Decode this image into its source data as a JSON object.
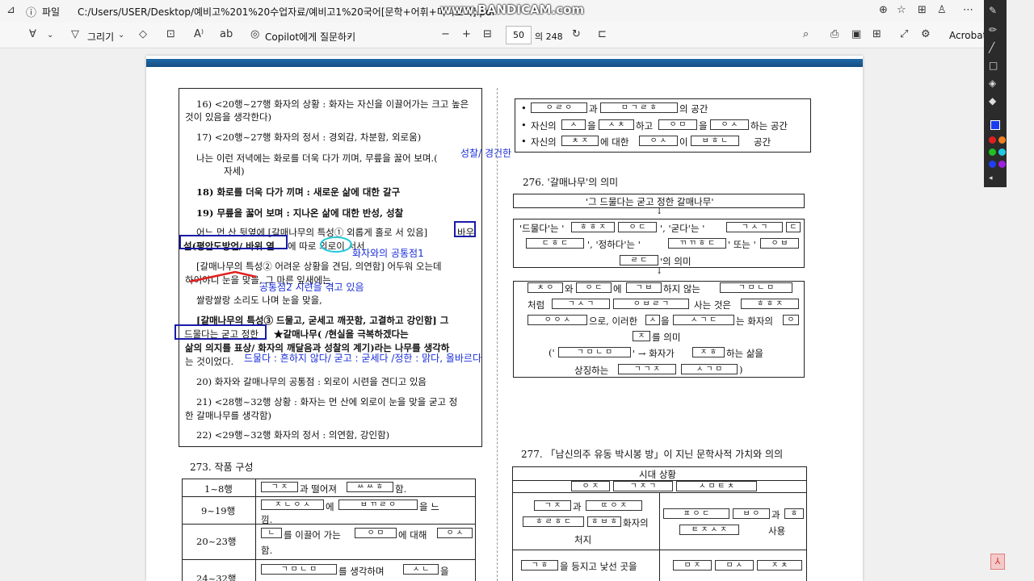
{
  "browser": {
    "file_label": "파일",
    "path": "C:/Users/USER/Desktop/예비고%201%20수업자료/예비고1%20국어[문학+어휘+미니모의].pdf",
    "watermark": "www.BANDICAM.com"
  },
  "toolbar": {
    "draw_label": "그리기",
    "copilot_label": "Copilot에게 질문하기",
    "page_current": "50",
    "page_total": "의 248",
    "acrobat_label": "Acrobat S"
  },
  "doc": {
    "left": {
      "l16a": "16) <20행~27행 화자의 상황 : 화자는 자신을 이끌어가는 크고 높은",
      "l16b": "것이 있음을 생각한다)",
      "l17": "17) <20행~27행 화자의 정서 : 경외감, 차분함, 외로움)",
      "l17t1": "나는 이런 저녁에는 화로를 더욱 다가 끼며, 무릎을 꿇어 보며.(",
      "l17t2": "자세)",
      "l18": "18) 화로를 더욱 다가 끼며 : 새로운 삶에 대한 갈구",
      "l19": "19) 무릎을 꿇어 보며 : 지나온 삶에 대한 반성, 성찰",
      "p1a": "어느 먼 산 뒷옆에 [갈매나무의 특성① 외롭게 홀로 서 있음]",
      "p1a_end": "바우",
      "p1b": "섶(평안도방언/ 바위 옆",
      "p1b2": "에 따로 외로이 서서",
      "p2a": "[갈매나무의 특성② 어려운 상황을 견딤, 의연함] 어두워 오는데",
      "p2b": "하이야니 눈을 맞을, 그 마른 잎새에는",
      "p2c": "쌀랑쌀랑 소리도 나며 눈을 맞을,",
      "p3a": "[갈매나무의 특성③ 드물고, 굳세고 깨끗함, 고결하고 강인함] 그",
      "p3b": "드물다는 굳고 정한",
      "p3b2": "★갈매나무(                    /현실을 극복하겠다는",
      "p3c": "삶의 의지를 표상/ 화자의 깨달음과 성찰의 계기)라는 나무를 생각하",
      "p3d": "는 것이었다.",
      "l20": "20) 화자와 갈매나무의 공통점 : 외로이 시련을 견디고 있음",
      "l21a": "21) <28행~32행 상황 : 화자는 먼 산에 외로이 눈을 맞을 굳고 정",
      "l21b": "한 갈매나무를 생각함)",
      "l22": "22) <29행~32행 화자의 정서 : 의연함, 강인함)",
      "h273": "273. 작품 구성",
      "rows": [
        {
          "range": "1~8행",
          "text": "과 떨어져",
          "box1": "ㄱ ㅈ",
          "box2": "ㅆ ㅆ ㅎ",
          "end": "함."
        },
        {
          "range": "9~19행",
          "text": "에",
          "box1": "ㅈ ㄴ ㅇ ㅅ",
          "box2": "ㅂ ㄲ ㄹ ㅇ",
          "end": "을 느",
          "line2": "낌."
        },
        {
          "range": "20~23행",
          "text": "를 이끌어 가는",
          "box1": "ㄴ",
          "box2": "ㅇ ㅁ",
          "end": "에 대해",
          "box3": "ㅇ ㅅ",
          "line2": "함."
        },
        {
          "range": "24~32행",
          "text": "를 생각하며",
          "box1": "ㄱ ㅁ ㄴ ㅁ",
          "box2": "ㅅ ㄴ",
          "end": "을"
        }
      ]
    },
    "right": {
      "bul1_box1": "ㅇ ㄹ ㅇ",
      "bul1_t1": "과",
      "bul1_box2": "ㅁ ㄱ ㄹ ㅎ",
      "bul1_t2": "의 공간",
      "bul2_t1": "자신의",
      "bul2_box1": "ㅅ",
      "bul2_t2": "을",
      "bul2_box2": "ㅅ ㅊ",
      "bul2_t3": "하고",
      "bul2_box3": "ㅇ ㅁ",
      "bul2_t4": "을",
      "bul2_box4": "ㅇ ㅅ",
      "bul2_t5": "하는 공간",
      "bul3_t1": "자신의",
      "bul3_box1": "ㅊ ㅈ",
      "bul3_t2": "에 대한",
      "bul3_box2": "ㅇ ㅅ",
      "bul3_t3": "이",
      "bul3_box3": "ㅂ ㅎ ㄴ",
      "bul3_t4": "공간",
      "h276": "276. '갈매나무'의 의미",
      "quote": "'그 드물다는 굳고 정한 갈매나무'",
      "m1_a": "'드물다'는 '",
      "m1_b1": "ㅎ ㅎ ㅈ",
      "m1_b2": "ㅇ ㄷ",
      "m1_c": "', '굳다'는 '",
      "m1_b3": "ㄱ ㅅ ㄱ",
      "m1_b4": "ㄷ",
      "m2_b1": "ㄷ ㅎ ㄷ",
      "m2_a": "', '정하다'는 '",
      "m2_b2": "ㄲ ㄲ ㅎ ㄷ",
      "m2_c": "' 또는 '",
      "m2_b3": "ㅇ ㅂ",
      "m3_b1": "ㄹ ㄷ",
      "m3_a": "'의 의미",
      "m4_b1": "ㅊ ㅇ",
      "m4_a": "와",
      "m4_b2": "ㅇ ㄷ",
      "m4_c": "에",
      "m4_b3": "ㄱ ㅂ",
      "m4_d": "하지 않는",
      "m4_b4": "ㄱ ㅁ ㄴ ㅁ",
      "m5_a": "처럼",
      "m5_b1": "ㄱ ㅅ ㄱ",
      "m5_b2": "ㅇ ㅂ ㄹ ㄱ",
      "m5_c": "사는 것은",
      "m5_b3": "ㅎ ㅎ ㅈ",
      "m6_b1": "ㅇ ㅇ ㅅ",
      "m6_a": "으로, 이러한",
      "m6_b2": "ㅅ",
      "m6_c": "을",
      "m6_b3": "ㅅ ㄱ ㄷ",
      "m6_d": "는 화자의",
      "m6_b4": "ㅇ",
      "m7_b1": "ㅈ",
      "m7_a": "를 의미",
      "m8_a": "('",
      "m8_b1": "ㄱ ㅁ ㄴ ㅁ",
      "m8_c": "' → 화자가",
      "m8_b2": "ㅈ ㅎ",
      "m8_d": "하는 삶을",
      "m9_a": "상징하는",
      "m9_b1": "ㄱ ㄱ ㅈ",
      "m9_b2": "ㅅ ㄱ ㅁ",
      "m9_c": ")",
      "h277": "277. 「남신의주 유동 박시봉 방」이 지닌 문학사적 가치와 의의",
      "t277_head": "시대 상황",
      "t277_r1b1": "ㅇ ㅈ",
      "t277_r1b2": "ㄱ ㅈ ㄱ",
      "t277_r1b3": "ㅅ ㅁ ㅌ ㅊ",
      "t277_l1b1": "ㄱ ㅈ",
      "t277_l1a": "과",
      "t277_l1b2": "ㄸ ㅇ ㅈ",
      "t277_l2b1": "ㅎ ㄹ ㅎ ㄷ",
      "t277_l2b2": "ㅎ ㅂ ㅎ",
      "t277_l2a": "화자의",
      "t277_l3": "처지",
      "t277_rr1b1": "ㅍ ㅇ ㄷ",
      "t277_rr1b2": "ㅂ ㅇ",
      "t277_rr1a": "과",
      "t277_rr1b3": "ㅎ",
      "t277_rr2b1": "ㅌ ㅈ ㅅ ㅈ",
      "t277_rr2a": "사용",
      "t277_l4b1": "ㄱ ㅎ",
      "t277_l4a": "을 등지고 낯선 곳을",
      "t277_rr3b1": "ㅁ ㅈ",
      "t277_rr3b2": "ㅁ ㅅ",
      "t277_rr3b3": "ㅈ ㅊ"
    }
  },
  "annotations": {
    "seongchal": "성찰/ 경건한",
    "common1": "화자와의 공통점1",
    "common2": "공통점2 시련을 겪고 있음",
    "meaning": "드물다 : 흔하지 않다/ 굳고 : 굳세다 /정한 : 맑다, 올바르다"
  },
  "colors": {
    "ink": "#1a2ed8",
    "box": "#1a1aa8",
    "red": "#e02020",
    "cyan": "#22c8d8",
    "header": "#1f69a8"
  }
}
